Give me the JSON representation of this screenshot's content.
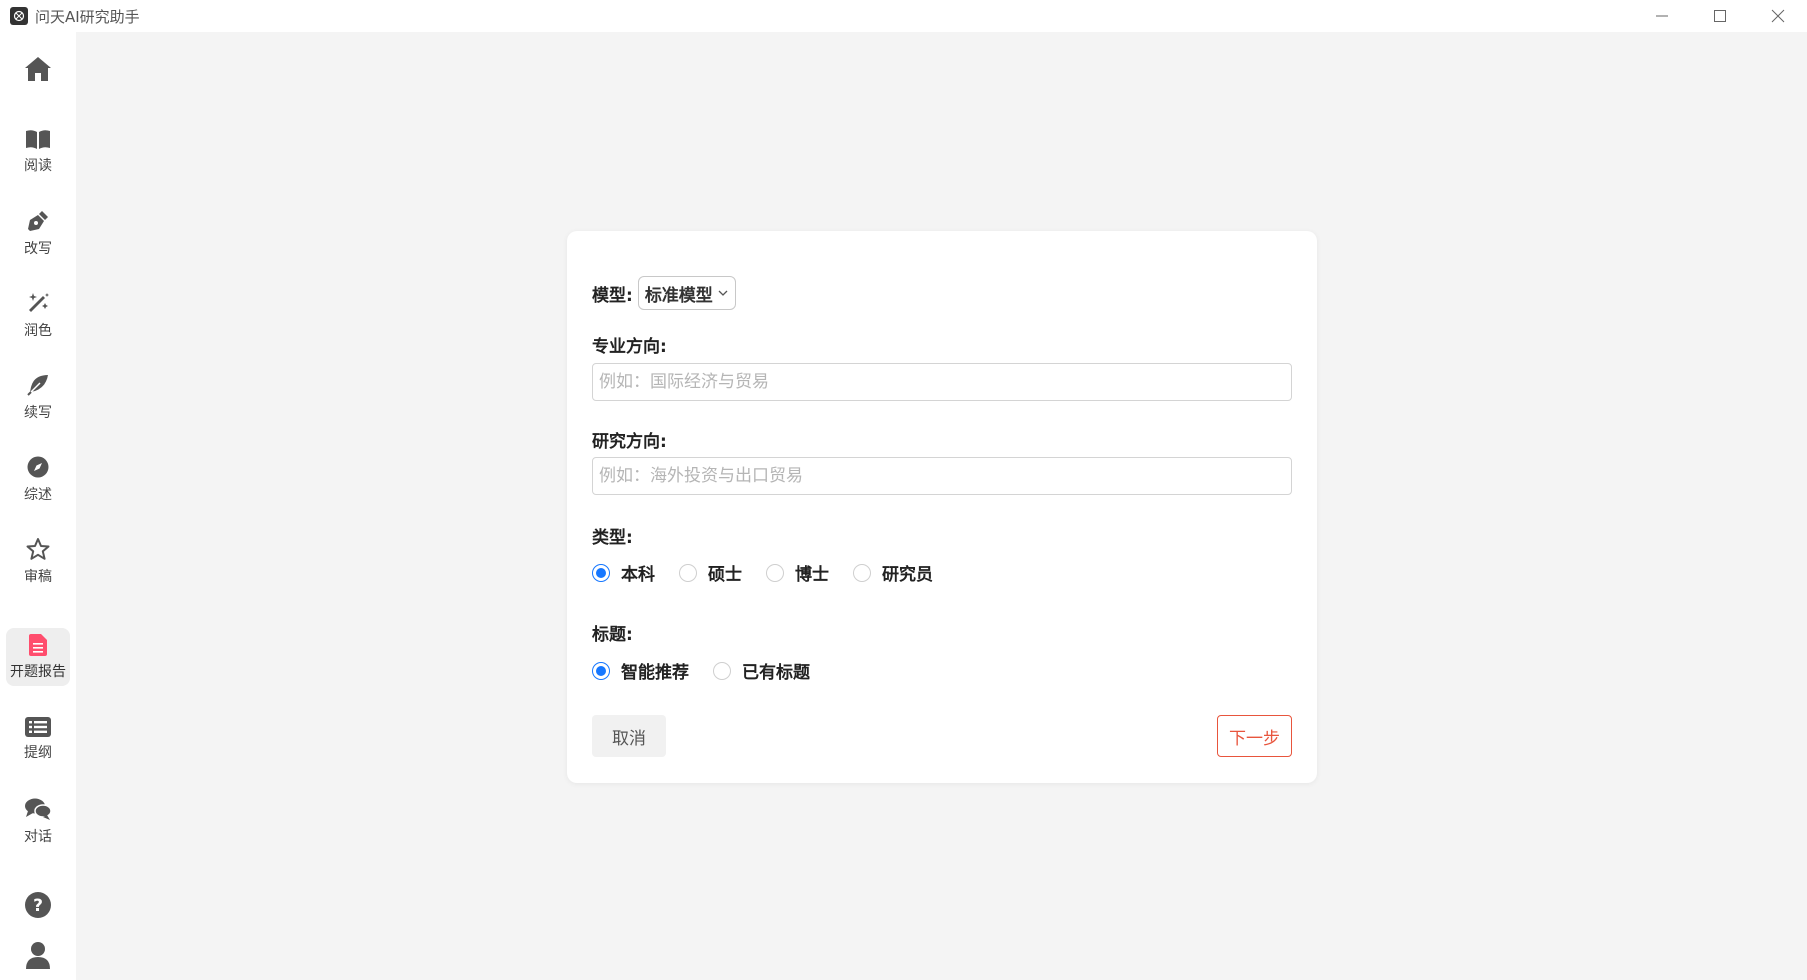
{
  "window": {
    "title": "问天AI研究助手",
    "controls": [
      "minimize-icon",
      "maximize-icon",
      "close-icon"
    ]
  },
  "sidebar": {
    "home_icon": "home-icon",
    "items": [
      {
        "label": "阅读",
        "icon": "book-icon"
      },
      {
        "label": "改写",
        "icon": "pen-icon"
      },
      {
        "label": "润色",
        "icon": "magic-wand-icon"
      },
      {
        "label": "续写",
        "icon": "feather-icon"
      },
      {
        "label": "综述",
        "icon": "compass-icon"
      },
      {
        "label": "审稿",
        "icon": "star-icon"
      },
      {
        "label": "开题报告",
        "icon": "document-icon",
        "active": true
      },
      {
        "label": "提纲",
        "icon": "list-icon"
      },
      {
        "label": "对话",
        "icon": "chat-icon"
      }
    ],
    "bottom_icons": [
      "help-icon",
      "user-icon"
    ]
  },
  "form": {
    "model_label": "模型:",
    "model_value": "标准模型",
    "major_label": "专业方向:",
    "major_placeholder": "例如：国际经济与贸易",
    "research_label": "研究方向:",
    "research_placeholder": "例如：海外投资与出口贸易",
    "type_label": "类型:",
    "type_options": [
      "本科",
      "硕士",
      "博士",
      "研究员"
    ],
    "type_selected": "本科",
    "title_label": "标题:",
    "title_options": [
      "智能推荐",
      "已有标题"
    ],
    "title_selected": "智能推荐",
    "cancel_label": "取消",
    "next_label": "下一步"
  },
  "colors": {
    "accent": "#1677ff",
    "next_button": "#e8553d",
    "active_icon": "#ff4d6d",
    "icon": "#555555"
  }
}
